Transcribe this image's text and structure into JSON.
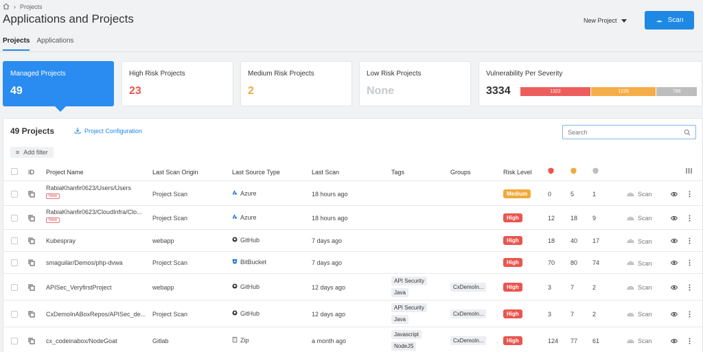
{
  "breadcrumb": {
    "current": "Projects"
  },
  "header": {
    "title": "Applications and Projects",
    "new_project": "New Project",
    "scan": "Scan"
  },
  "tabs": [
    {
      "label": "Projects",
      "active": true
    },
    {
      "label": "Applications",
      "active": false
    }
  ],
  "cards": {
    "managed": {
      "label": "Managed Projects",
      "value": "49"
    },
    "high": {
      "label": "High Risk Projects",
      "value": "23",
      "color": "#e9554f"
    },
    "medium": {
      "label": "Medium Risk Projects",
      "value": "2",
      "color": "#f0a93a"
    },
    "low": {
      "label": "Low Risk Projects",
      "value": "None",
      "color": "#c6c8cc"
    },
    "severity": {
      "label": "Vulnerability Per Severity",
      "total": "3334",
      "segments": [
        {
          "value": "1322",
          "color": "#ee5d5d",
          "share": 0.4
        },
        {
          "value": "1226",
          "color": "#f5ad47",
          "share": 0.37
        },
        {
          "value": "786",
          "color": "#bdbdbd",
          "share": 0.23
        }
      ]
    }
  },
  "table": {
    "title": "49 Projects",
    "config_label": "Project Configuration",
    "search_placeholder": "Search",
    "add_filter": "Add filter",
    "headers": {
      "id": "ID",
      "name": "Project Name",
      "origin": "Last Scan Origin",
      "source": "Last Source Type",
      "last_scan": "Last Scan",
      "tags": "Tags",
      "groups": "Groups",
      "risk": "Risk Level"
    },
    "row_scan_label": "Scan",
    "rows": [
      {
        "name": "RabiaKhanfir0623/Users/Users",
        "new": "New",
        "origin": "Project Scan",
        "source": "Azure",
        "source_icon": "azure-icon",
        "last_scan": "18 hours ago",
        "tags": [],
        "group": "",
        "risk": "Medium",
        "risk_color": "#f0a93a",
        "high": "0",
        "medium": "5",
        "low": "1"
      },
      {
        "name": "RabiaKhanfir0623/CloudInfra/Clo...",
        "new": "New",
        "origin": "Project Scan",
        "source": "Azure",
        "source_icon": "azure-icon",
        "last_scan": "18 hours ago",
        "tags": [],
        "group": "",
        "risk": "High",
        "risk_color": "#e9554f",
        "high": "12",
        "medium": "18",
        "low": "9"
      },
      {
        "name": "Kubespray",
        "new": "",
        "origin": "webapp",
        "source": "GitHub",
        "source_icon": "github-icon",
        "last_scan": "7 days ago",
        "tags": [],
        "group": "",
        "risk": "High",
        "risk_color": "#e9554f",
        "high": "18",
        "medium": "40",
        "low": "17"
      },
      {
        "name": "smaguilar/Demos/php-dvwa",
        "new": "",
        "origin": "Project Scan",
        "source": "BitBucket",
        "source_icon": "bitbucket-icon",
        "last_scan": "7 days ago",
        "tags": [],
        "group": "",
        "risk": "High",
        "risk_color": "#e9554f",
        "high": "70",
        "medium": "80",
        "low": "74"
      },
      {
        "name": "APISec_VeryfirstProject",
        "new": "",
        "origin": "webapp",
        "source": "GitHub",
        "source_icon": "github-icon",
        "last_scan": "12 days ago",
        "tags": [
          "API Security",
          "Java"
        ],
        "group": "CxDemoIn...",
        "risk": "High",
        "risk_color": "#e9554f",
        "high": "3",
        "medium": "7",
        "low": "2"
      },
      {
        "name": "CxDemoInABoxRepos/APISec_de...",
        "new": "",
        "origin": "Project Scan",
        "source": "GitHub",
        "source_icon": "github-icon",
        "last_scan": "12 days ago",
        "tags": [
          "API Security",
          "Java"
        ],
        "group": "CxDemoIn...",
        "risk": "High",
        "risk_color": "#e9554f",
        "high": "3",
        "medium": "7",
        "low": "2"
      },
      {
        "name": "cx_codeinabox/NodeGoat",
        "new": "",
        "origin": "Gitlab",
        "source": "Zip",
        "source_icon": "zip-icon",
        "last_scan": "a month ago",
        "tags": [
          "Javascript",
          "NodeJS"
        ],
        "group": "CxDemoIn...",
        "risk": "High",
        "risk_color": "#e9554f",
        "high": "124",
        "medium": "77",
        "low": "61"
      }
    ]
  }
}
